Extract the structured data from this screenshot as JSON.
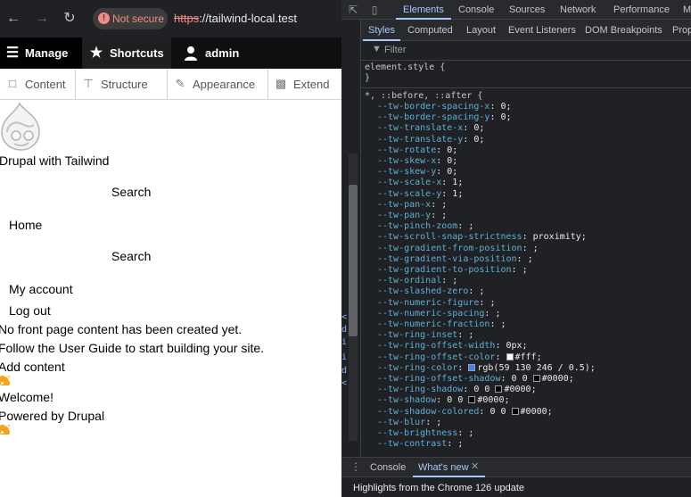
{
  "browser": {
    "not_secure_label": "Not secure",
    "url_scheme": "https",
    "url_rest": "://tailwind-local.test",
    "icons": {
      "back": "back-arrow-icon",
      "forward": "forward-arrow-icon",
      "reload": "reload-icon",
      "warning": "warning-icon"
    }
  },
  "toolbar": {
    "manage": "Manage",
    "shortcuts": "Shortcuts",
    "admin": "admin"
  },
  "tray": {
    "items": [
      {
        "label": "Content",
        "icon": "file-icon"
      },
      {
        "label": "Structure",
        "icon": "sitemap-icon"
      },
      {
        "label": "Appearance",
        "icon": "paintbrush-icon"
      },
      {
        "label": "Extend",
        "icon": "puzzle-icon"
      }
    ]
  },
  "page": {
    "site_name": "Drupal with Tailwind",
    "search_label_1": "Search",
    "nav_home": "Home",
    "search_label_2": "Search",
    "nav_my_account": "My account",
    "nav_log_out": "Log out",
    "no_content": "No front page content has been created yet.",
    "user_guide": "Follow the User Guide to start building your site.",
    "add_content": "Add content",
    "welcome": "Welcome!",
    "powered_by": "Powered by Drupal"
  },
  "devtools": {
    "tabs": [
      "Elements",
      "Console",
      "Sources",
      "Network",
      "Performance",
      "M"
    ],
    "active_tab": "Elements",
    "subtabs": [
      "Styles",
      "Computed",
      "Layout",
      "Event Listeners",
      "DOM Breakpoints",
      "Prop"
    ],
    "active_subtab": "Styles",
    "filter_placeholder": "Filter",
    "element_style_selector": "element.style {",
    "element_style_close": "}",
    "universal_selector": "*, ::before, ::after {",
    "declarations": [
      {
        "prop": "--tw-border-spacing-x",
        "val": "0;"
      },
      {
        "prop": "--tw-border-spacing-y",
        "val": "0;"
      },
      {
        "prop": "--tw-translate-x",
        "val": "0;"
      },
      {
        "prop": "--tw-translate-y",
        "val": "0;"
      },
      {
        "prop": "--tw-rotate",
        "val": "0;"
      },
      {
        "prop": "--tw-skew-x",
        "val": "0;"
      },
      {
        "prop": "--tw-skew-y",
        "val": "0;"
      },
      {
        "prop": "--tw-scale-x",
        "val": "1;"
      },
      {
        "prop": "--tw-scale-y",
        "val": "1;"
      },
      {
        "prop": "--tw-pan-x",
        "val": " ;"
      },
      {
        "prop": "--tw-pan-y",
        "val": " ;"
      },
      {
        "prop": "--tw-pinch-zoom",
        "val": " ;"
      },
      {
        "prop": "--tw-scroll-snap-strictness",
        "val": "proximity;"
      },
      {
        "prop": "--tw-gradient-from-position",
        "val": " ;"
      },
      {
        "prop": "--tw-gradient-via-position",
        "val": " ;"
      },
      {
        "prop": "--tw-gradient-to-position",
        "val": " ;"
      },
      {
        "prop": "--tw-ordinal",
        "val": " ;"
      },
      {
        "prop": "--tw-slashed-zero",
        "val": " ;"
      },
      {
        "prop": "--tw-numeric-figure",
        "val": " ;"
      },
      {
        "prop": "--tw-numeric-spacing",
        "val": " ;"
      },
      {
        "prop": "--tw-numeric-fraction",
        "val": " ;"
      },
      {
        "prop": "--tw-ring-inset",
        "val": " ;"
      },
      {
        "prop": "--tw-ring-offset-width",
        "val": "0px;"
      },
      {
        "prop": "--tw-ring-offset-color",
        "val": "#fff;",
        "swatch": "#ffffff"
      },
      {
        "prop": "--tw-ring-color",
        "val": "rgb(59 130 246 / 0.5);",
        "swatch": "#3b82f6"
      },
      {
        "prop": "--tw-ring-offset-shadow",
        "val": "0 0 #0000;",
        "swatch": "#000000",
        "swatch_after": "0 0 "
      },
      {
        "prop": "--tw-ring-shadow",
        "val": "0 0 #0000;",
        "swatch": "#000000",
        "swatch_after": "0 0 "
      },
      {
        "prop": "--tw-shadow",
        "val": "0 0 #0000;",
        "swatch": "#000000",
        "swatch_after": "0 0 "
      },
      {
        "prop": "--tw-shadow-colored",
        "val": "0 0 #0000;",
        "swatch": "#000000",
        "swatch_after": "0 0 "
      },
      {
        "prop": "--tw-blur",
        "val": " ;"
      },
      {
        "prop": "--tw-brightness",
        "val": " ;"
      },
      {
        "prop": "--tw-contrast",
        "val": " ;"
      }
    ],
    "drawer_tabs": [
      "Console",
      "What's new"
    ],
    "drawer_active": "What's new",
    "drawer_message": "Highlights from the Chrome 126 update"
  }
}
